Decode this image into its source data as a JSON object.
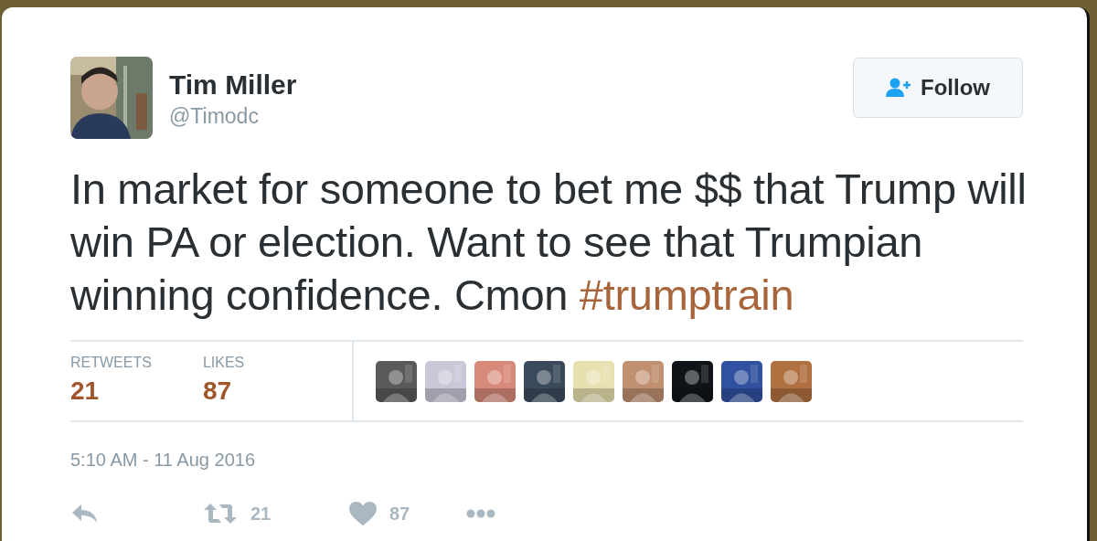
{
  "author": {
    "name": "Tim Miller",
    "handle": "@Timodc"
  },
  "follow_button": {
    "label": "Follow"
  },
  "tweet": {
    "text": "In market for someone to bet me $$ that Trump will win PA or election. Want to see that Trumpian winning confidence. Cmon",
    "hashtag": "#trumptrain"
  },
  "stats": [
    {
      "label": "RETWEETS",
      "value": "21"
    },
    {
      "label": "LIKES",
      "value": "87"
    }
  ],
  "timestamp": "5:10 AM - 11 Aug 2016",
  "actions": [
    {
      "kind": "reply"
    },
    {
      "kind": "retweet",
      "count": "21"
    },
    {
      "kind": "like",
      "count": "87"
    },
    {
      "kind": "more"
    }
  ]
}
